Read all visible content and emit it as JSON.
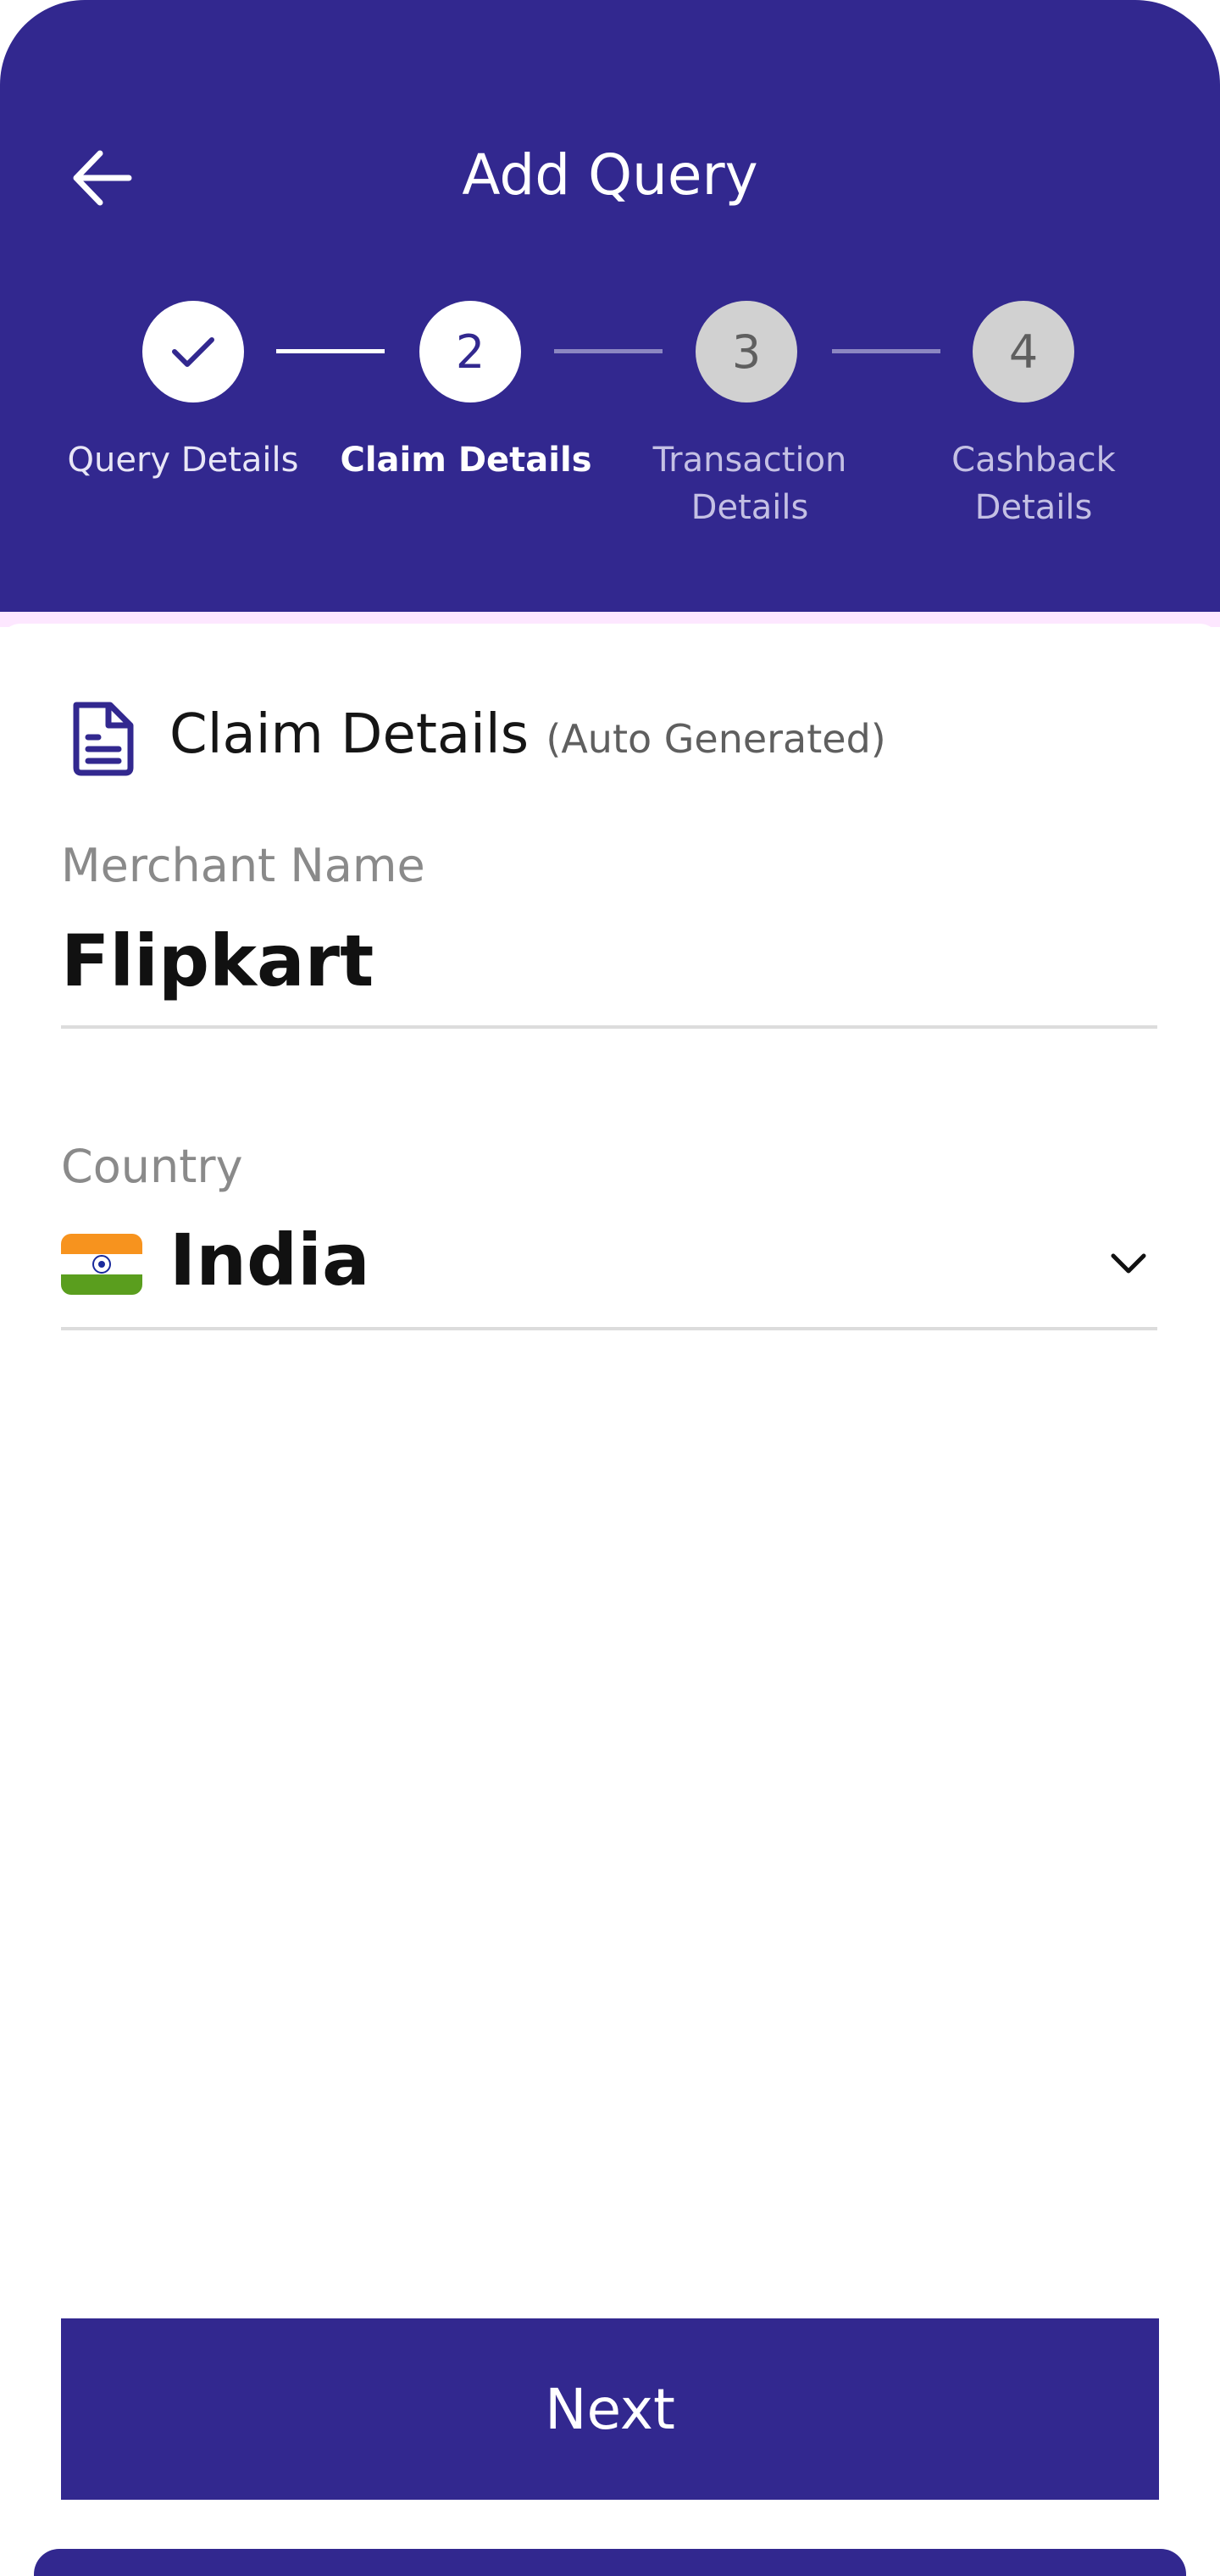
{
  "header": {
    "title": "Add Query",
    "back_icon": "arrow-left-icon"
  },
  "stepper": {
    "current_step": 2,
    "steps": [
      {
        "number": "",
        "label_line1": "Query Details",
        "label_line2": "",
        "status": "completed",
        "icon": "checkmark-icon"
      },
      {
        "number": "2",
        "label_line1": "Claim Details",
        "label_line2": "",
        "status": "active"
      },
      {
        "number": "3",
        "label_line1": "Transaction",
        "label_line2": "Details",
        "status": "pending"
      },
      {
        "number": "4",
        "label_line1": "Cashback",
        "label_line2": "Details",
        "status": "pending"
      }
    ]
  },
  "section": {
    "icon": "document-icon",
    "title": "Claim Details",
    "subtitle": "(Auto Generated)"
  },
  "merchant": {
    "label": "Merchant Name",
    "value": "Flipkart"
  },
  "country": {
    "label": "Country",
    "value": "India",
    "flag_icon": "india-flag-icon",
    "dropdown_icon": "chevron-down-icon"
  },
  "footer": {
    "next_label": "Next"
  },
  "colors": {
    "primary": "#32288f",
    "pending_step": "#d1d1d1",
    "accent_strip": "#fde7ff"
  }
}
